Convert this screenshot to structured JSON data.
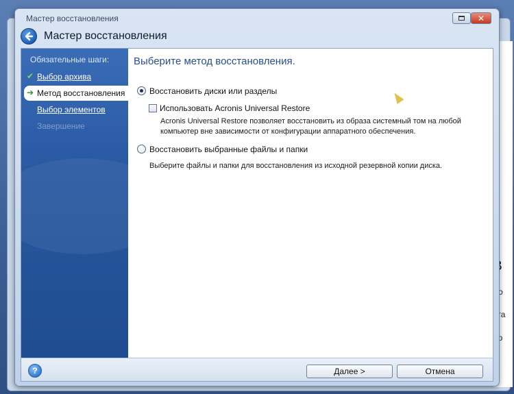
{
  "window": {
    "title": "Мастер восстановления",
    "header_title": "Мастер восстановления",
    "restore_icon": "restore-window-icon",
    "close_glyph": "✕"
  },
  "sidebar": {
    "heading": "Обязательные шаги:",
    "steps": [
      {
        "label": "Выбор архива",
        "state": "done",
        "icon": "check-icon"
      },
      {
        "label": "Метод восстановления",
        "state": "current",
        "icon": "arrow-right-icon"
      },
      {
        "label": "Выбор элементов",
        "state": "link"
      },
      {
        "label": "Завершение",
        "state": "disabled"
      }
    ]
  },
  "main": {
    "title": "Выберите метод восстановления.",
    "options": [
      {
        "label": "Восстановить диски или разделы",
        "selected": true,
        "sub_checkbox": {
          "label": "Использовать Acronis Universal Restore",
          "checked": false,
          "description_line1": "Acronis Universal Restore позволяет восстановить из образа системный том на любой",
          "description_line2": "компьютер вне зависимости от конфигурации аппаратного обеспечения."
        }
      },
      {
        "label": "Восстановить выбранные файлы и папки",
        "selected": false,
        "description": "Выберите файлы и папки для восстановления из исходной резервной копии диска."
      }
    ]
  },
  "footer": {
    "help_glyph": "?",
    "next_label": "Далее >",
    "cancel_label": "Отмена"
  },
  "background": {
    "snippets": [
      "В",
      "ло",
      "кта",
      "ер"
    ]
  },
  "colors": {
    "sidebar_blue": "#2a5aa3",
    "title_blue": "#26508c",
    "close_red": "#c33b22"
  }
}
